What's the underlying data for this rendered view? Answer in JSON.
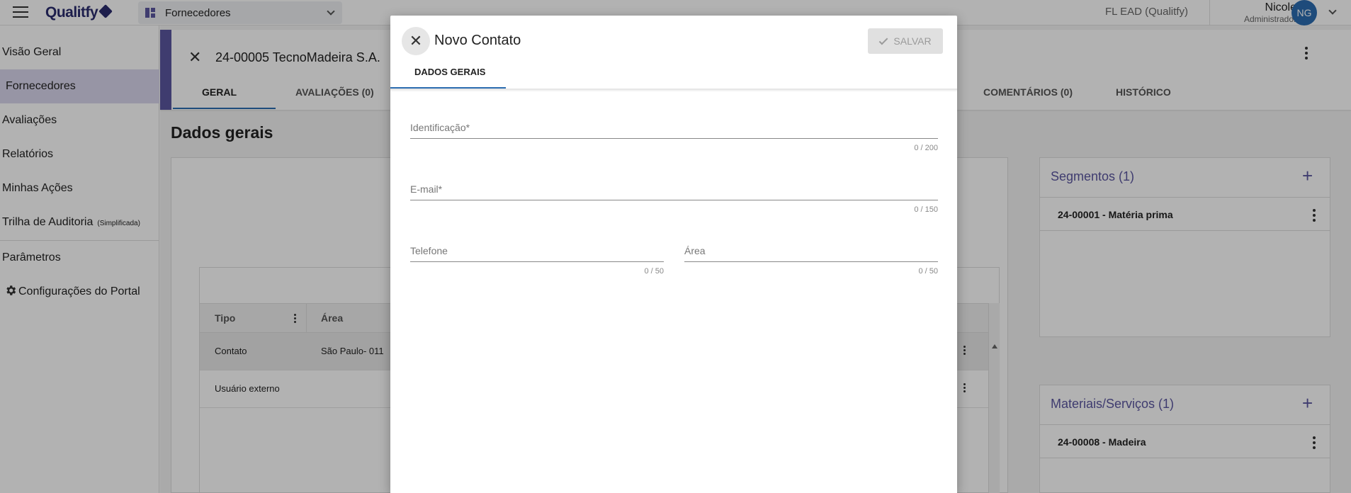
{
  "topbar": {
    "brand": "Qualitfy",
    "module": "Fornecedores",
    "tenant": "FL EAD (Qualitfy)",
    "user_name": "Nicole",
    "user_role": "Administrador",
    "avatar_initials": "NG"
  },
  "sidebar": {
    "items": [
      {
        "label": "Visão Geral"
      },
      {
        "label": "Fornecedores"
      },
      {
        "label": "Avaliações"
      },
      {
        "label": "Relatórios"
      },
      {
        "label": "Minhas Ações"
      },
      {
        "label": "Trilha de Auditoria",
        "sub": "(Simplificada)"
      },
      {
        "label": "Parâmetros"
      },
      {
        "label": "Configurações do Portal"
      }
    ]
  },
  "record": {
    "title": "24-00005 TecnoMadeira S.A.",
    "tabs": [
      "GERAL",
      "AVALIAÇÕES (0)",
      "COMENTÁRIOS (0)",
      "HISTÓRICO"
    ]
  },
  "main": {
    "section_title": "Dados gerais",
    "table": {
      "headers": [
        "Tipo",
        "Área"
      ],
      "rows": [
        {
          "tipo": "Contato",
          "area": "São Paulo- 011"
        },
        {
          "tipo": "Usuário externo",
          "area": ""
        }
      ]
    },
    "segments": {
      "title": "Segmentos (1)",
      "item": "24-00001 - Matéria prima"
    },
    "materials": {
      "title": "Materiais/Serviços (1)",
      "item": "24-00008 - Madeira"
    }
  },
  "dialog": {
    "title": "Novo Contato",
    "save_label": "SALVAR",
    "tab": "DADOS GERAIS",
    "fields": {
      "identificacao": {
        "label": "Identificação*",
        "value": "",
        "count": "0 / 200"
      },
      "email": {
        "label": "E-mail*",
        "value": "",
        "count": "0 / 150"
      },
      "telefone": {
        "label": "Telefone",
        "value": "",
        "count": "0 / 50"
      },
      "area": {
        "label": "Área",
        "value": "",
        "count": "0 / 50"
      }
    }
  },
  "colors": {
    "accent": "#5b56a0",
    "primary": "#2b6cb0",
    "scrim": "#000000"
  }
}
